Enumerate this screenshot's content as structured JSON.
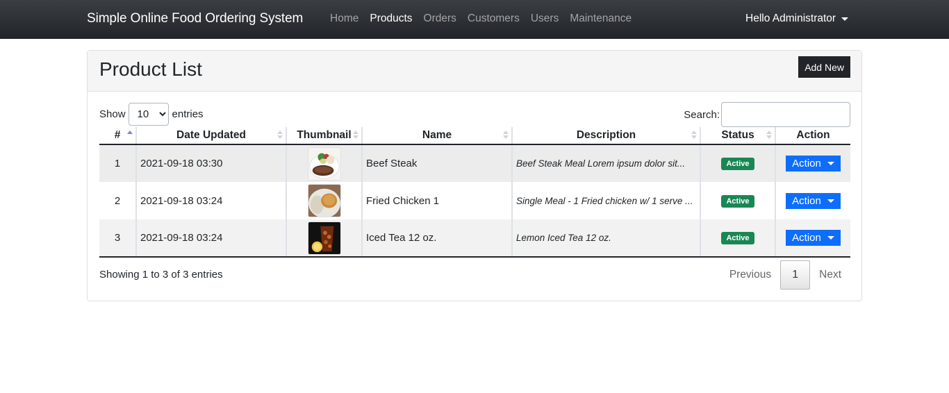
{
  "navbar": {
    "brand": "Simple Online Food Ordering System",
    "links": [
      {
        "label": "Home",
        "active": false
      },
      {
        "label": "Products",
        "active": true
      },
      {
        "label": "Orders",
        "active": false
      },
      {
        "label": "Customers",
        "active": false
      },
      {
        "label": "Users",
        "active": false
      },
      {
        "label": "Maintenance",
        "active": false
      }
    ],
    "user_menu": "Hello Administrator"
  },
  "card": {
    "title": "Product List",
    "add_button": "Add New"
  },
  "table_controls": {
    "show_label": "Show",
    "entries_label": "entries",
    "page_length": "10",
    "search_label": "Search:",
    "search_value": ""
  },
  "table": {
    "columns": [
      "#",
      "Date Updated",
      "Thumbnail",
      "Name",
      "Description",
      "Status",
      "Action"
    ],
    "sorted_column": "#",
    "rows": [
      {
        "num": "1",
        "date": "2021-09-18 03:30",
        "thumbnail": "beef-steak-image",
        "name": "Beef Steak",
        "description": "Beef Steak Meal Lorem ipsum dolor sit...",
        "status": "Active",
        "action": "Action"
      },
      {
        "num": "2",
        "date": "2021-09-18 03:24",
        "thumbnail": "fried-chicken-image",
        "name": "Fried Chicken 1",
        "description": "Single Meal - 1 Fried chicken w/ 1 serve ...",
        "status": "Active",
        "action": "Action"
      },
      {
        "num": "3",
        "date": "2021-09-18 03:24",
        "thumbnail": "iced-tea-image",
        "name": "Iced Tea 12 oz.",
        "description": "Lemon Iced Tea 12 oz.",
        "status": "Active",
        "action": "Action"
      }
    ]
  },
  "footer": {
    "info": "Showing 1 to 3 of 3 entries",
    "previous": "Previous",
    "current_page": "1",
    "next": "Next"
  },
  "colors": {
    "status_active": "#198754",
    "action_button": "#0d6efd",
    "add_button": "#212529"
  }
}
